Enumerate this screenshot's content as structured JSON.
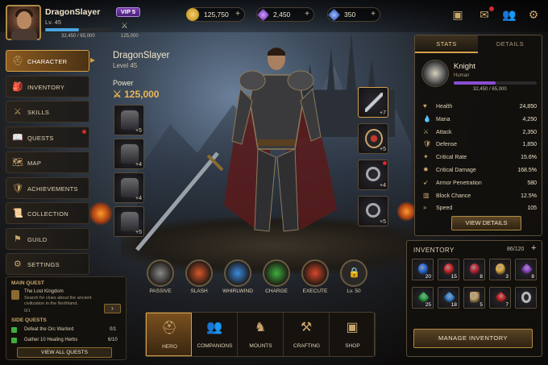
{
  "player": {
    "name": "DragonSlayer",
    "level": "Lv. 45",
    "xp": "32,450 / 65,000",
    "xp_fraction": 0.5,
    "vip": "VIP 5",
    "power_small": "125,000"
  },
  "currency": [
    {
      "name": "gold",
      "value": "125,750",
      "color": "#e0b040"
    },
    {
      "name": "amethyst",
      "value": "2,450",
      "color": "#9b4fd8"
    },
    {
      "name": "sapphire",
      "value": "350",
      "color": "#3f6fd8"
    }
  ],
  "top_icons": [
    "chest-icon",
    "mail-icon",
    "friends-icon",
    "gear-icon"
  ],
  "menu": [
    {
      "label": "CHARACTER",
      "icon": "helmet-icon",
      "active": true
    },
    {
      "label": "INVENTORY",
      "icon": "bag-icon"
    },
    {
      "label": "SKILLS",
      "icon": "swords-icon"
    },
    {
      "label": "QUESTS",
      "icon": "book-icon",
      "dot": true
    },
    {
      "label": "MAP",
      "icon": "map-icon"
    },
    {
      "label": "ACHIEVEMENTS",
      "icon": "shield-icon"
    },
    {
      "label": "COLLECTION",
      "icon": "scroll-icon"
    },
    {
      "label": "GUILD",
      "icon": "banner-icon"
    },
    {
      "label": "SETTINGS",
      "icon": "gear-icon"
    }
  ],
  "quests": {
    "main_header": "MAIN QUEST",
    "main_title": "The Lost Kingdom",
    "main_desc": "Search for clues about the ancient civilization in the Northland.",
    "main_progress": "0/1",
    "side_header": "SIDE QUESTS",
    "side": [
      {
        "title": "Defeat the Orc Warlord",
        "progress": "0/1"
      },
      {
        "title": "Gather 10 Healing Herbs",
        "progress": "6/10"
      }
    ],
    "view_all": "VIEW ALL QUESTS"
  },
  "hero": {
    "name": "DragonSlayer",
    "level": "Level 45",
    "power_label": "Power",
    "power": "125,000"
  },
  "equipment_left": [
    "+5",
    "+4",
    "+4",
    "+5"
  ],
  "equipment_right": [
    "+7",
    "+5",
    "+4",
    "+5"
  ],
  "skills": [
    {
      "label": "PASSIVE",
      "color": "#8a8a8a"
    },
    {
      "label": "SLASH",
      "color": "#d8572a"
    },
    {
      "label": "WHIRLWIND",
      "color": "#3a8adf"
    },
    {
      "label": "CHARGE",
      "color": "#3fae3f"
    },
    {
      "label": "EXECUTE",
      "color": "#d8472a"
    },
    {
      "label": "Lv. 50",
      "color": "#444444"
    }
  ],
  "nav": [
    "HERO",
    "COMPANIONS",
    "MOUNTS",
    "CRAFTING",
    "SHOP"
  ],
  "stats": {
    "tabs": [
      "STATS",
      "DETAILS"
    ],
    "class": "Knight",
    "subclass": "Human",
    "xp": "32,450 / 65,000",
    "xp_fraction": 0.5,
    "rows": [
      {
        "label": "Health",
        "value": "24,850"
      },
      {
        "label": "Mana",
        "value": "4,250"
      },
      {
        "label": "Attack",
        "value": "2,350"
      },
      {
        "label": "Defense",
        "value": "1,850"
      },
      {
        "label": "Critical Rate",
        "value": "15.6%"
      },
      {
        "label": "Critical Damage",
        "value": "168.5%"
      },
      {
        "label": "Armor Penetration",
        "value": "580"
      },
      {
        "label": "Block Chance",
        "value": "12.5%"
      },
      {
        "label": "Speed",
        "value": "105"
      }
    ],
    "view_details": "VIEW DETAILS"
  },
  "inventory": {
    "title": "INVENTORY",
    "count": "86/120",
    "items": [
      {
        "name": "blue-potion",
        "count": "20",
        "color": "#2f6fe0"
      },
      {
        "name": "red-potion",
        "count": "15",
        "color": "#d42a2a"
      },
      {
        "name": "red-flask",
        "count": "8",
        "color": "#c22a3a"
      },
      {
        "name": "gold-coin",
        "count": "3",
        "color": "#e0b040"
      },
      {
        "name": "purple-gem",
        "count": "8",
        "color": "#9b4fd8"
      },
      {
        "name": "green-gem",
        "count": "25",
        "color": "#2fae4f"
      },
      {
        "name": "blue-gem",
        "count": "18",
        "color": "#3f8fe0"
      },
      {
        "name": "scroll",
        "count": "5",
        "color": "#c9a66b"
      },
      {
        "name": "red-crystal",
        "count": "7",
        "color": "#d42a2a"
      },
      {
        "name": "ring",
        "count": "",
        "color": "#b8b8b8"
      }
    ],
    "manage": "MANAGE INVENTORY"
  }
}
